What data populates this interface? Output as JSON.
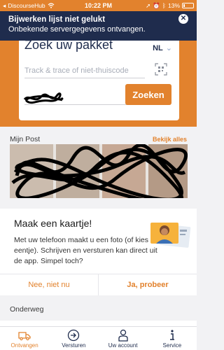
{
  "status_bar": {
    "carrier": "DiscourseHub",
    "time": "10:22 PM",
    "battery": "13%"
  },
  "error_banner": {
    "title": "Bijwerken lijst niet gelukt",
    "message": "Onbekende servergegevens ontvangen.",
    "close_icon": "close-icon"
  },
  "search": {
    "heading": "Zoek uw pakket",
    "language": "NL",
    "track_placeholder": "Track & trace of niet-thuiscode",
    "button_label": "Zoeken",
    "accent": "#e2822d"
  },
  "mijn_post": {
    "title": "Mijn Post",
    "see_all": "Bekijk alles"
  },
  "promo": {
    "title": "Maak een kaartje!",
    "body": "Met uw telefoon maakt u een foto (of kies er eentje). Schrijven en versturen kan direct uit de app. Simpel toch?",
    "decline_label": "Nee, niet nu",
    "accept_label": "Ja, probeer"
  },
  "onderweg": {
    "title": "Onderweg"
  },
  "tabs": [
    {
      "label": "Ontvangen",
      "icon": "truck-icon",
      "active": true
    },
    {
      "label": "Versturen",
      "icon": "send-arrow-icon",
      "active": false
    },
    {
      "label": "Uw account",
      "icon": "person-icon",
      "active": false
    },
    {
      "label": "Service",
      "icon": "info-icon",
      "active": false
    }
  ],
  "colors": {
    "brand_orange": "#e2822d",
    "navy": "#1f2c4d"
  }
}
